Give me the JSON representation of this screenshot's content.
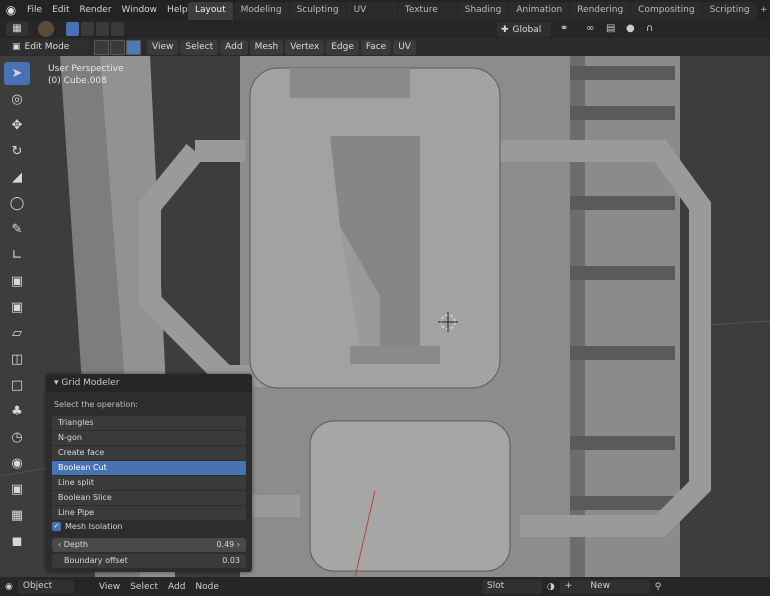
{
  "app": {
    "menus": [
      "File",
      "Edit",
      "Render",
      "Window",
      "Help"
    ],
    "workspaces": [
      "Layout",
      "Modeling",
      "Sculpting",
      "UV Editing",
      "Texture Paint",
      "Shading",
      "Animation",
      "Rendering",
      "Compositing",
      "Scripting"
    ],
    "active_workspace": "Layout",
    "add_workspace": "+"
  },
  "header": {
    "transform_orientation": "Global",
    "mode": "Edit Mode",
    "menus": [
      "View",
      "Select",
      "Add",
      "Mesh",
      "Vertex",
      "Edge",
      "Face",
      "UV"
    ]
  },
  "viewport": {
    "perspective_label": "User Perspective",
    "object_label": "(0) Cube.008"
  },
  "toolbar": {
    "tools": [
      "select-box-icon",
      "cursor-icon",
      "move-icon",
      "rotate-icon",
      "scale-icon",
      "transform-icon",
      "annotate-icon",
      "measure-icon",
      "extrude-icon",
      "inset-icon",
      "bevel-icon",
      "loop-cut-icon",
      "knife-icon",
      "poly-build-icon",
      "spin-icon",
      "smooth-icon",
      "shrink-fatten-icon",
      "shear-icon",
      "rip-icon"
    ],
    "active": 0
  },
  "operator": {
    "title": "Grid Modeler",
    "prompt": "Select the operation:",
    "options": [
      "Triangles",
      "N-gon",
      "Create face",
      "Boolean Cut",
      "Line split",
      "Boolean Slice",
      "Line Pipe"
    ],
    "selected": "Boolean Cut",
    "mesh_isolation": {
      "label": "Mesh Isolation",
      "checked": true
    },
    "depth": {
      "label": "Depth",
      "value": "0.49"
    },
    "boundary_offset": {
      "label": "Boundary offset",
      "value": "0.03"
    }
  },
  "bottombar": {
    "mode": "Object",
    "menus": [
      "View",
      "Select",
      "Add",
      "Node"
    ],
    "slot": "Slot",
    "new_label": "New"
  },
  "colors": {
    "accent": "#4772b3",
    "viewport_bg": "#3d3d3d",
    "header_bg": "#262626"
  }
}
